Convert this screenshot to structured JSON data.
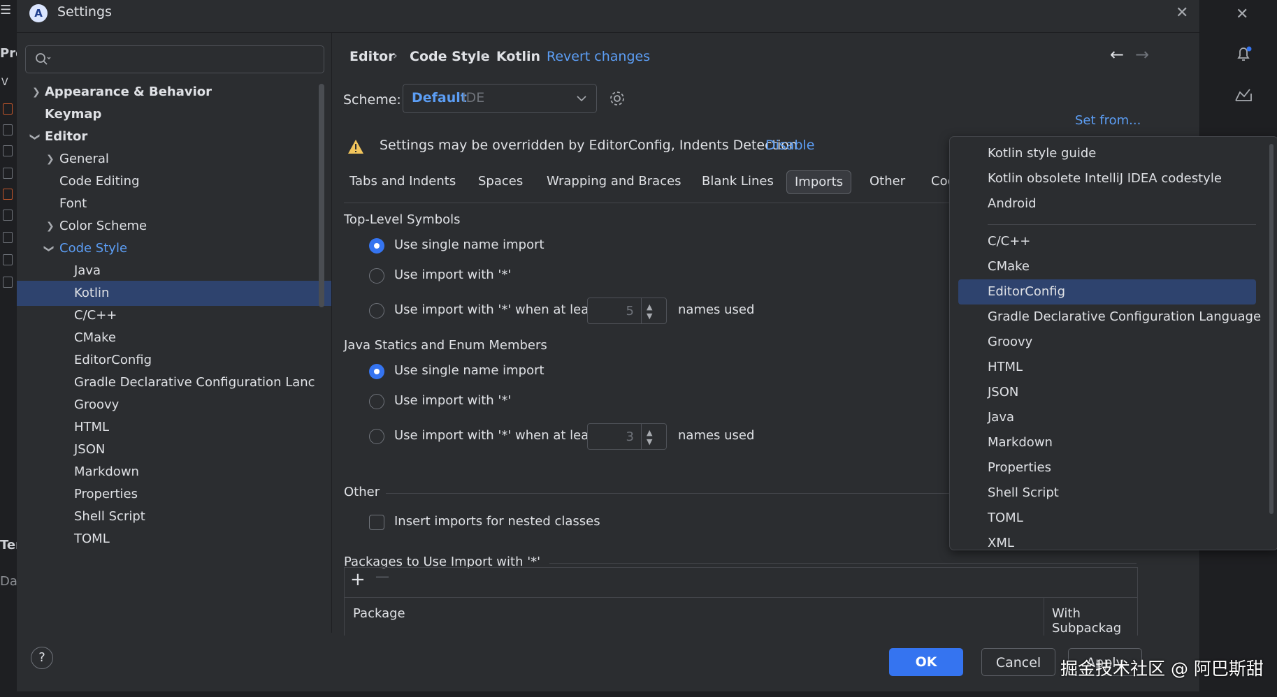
{
  "ide": {
    "left_fragments": [
      "Pro",
      "V",
      "Ter",
      "Da"
    ],
    "bell_icon": "bell-icon",
    "ai_icon": "ai-assistant-icon"
  },
  "window": {
    "title": "Settings",
    "logo_letter": "A"
  },
  "search": {
    "placeholder": ""
  },
  "sidebar": {
    "items": [
      {
        "label": "Appearance & Behavior"
      },
      {
        "label": "Keymap"
      },
      {
        "label": "Editor"
      },
      {
        "label": "General"
      },
      {
        "label": "Code Editing"
      },
      {
        "label": "Font"
      },
      {
        "label": "Color Scheme"
      },
      {
        "label": "Code Style"
      },
      {
        "label": "Java"
      },
      {
        "label": "Kotlin"
      },
      {
        "label": "C/C++"
      },
      {
        "label": "CMake"
      },
      {
        "label": "EditorConfig"
      },
      {
        "label": "Gradle Declarative Configuration Lanc"
      },
      {
        "label": "Groovy"
      },
      {
        "label": "HTML"
      },
      {
        "label": "JSON"
      },
      {
        "label": "Markdown"
      },
      {
        "label": "Properties"
      },
      {
        "label": "Shell Script"
      },
      {
        "label": "TOML"
      }
    ]
  },
  "breadcrumb": {
    "items": [
      "Editor",
      "Code Style",
      "Kotlin"
    ],
    "separator": "›",
    "revert": "Revert changes"
  },
  "nav": {
    "back": "←",
    "forward": "→"
  },
  "scheme": {
    "label": "Scheme:",
    "name": "Default",
    "type": "IDE",
    "set_from": "Set from..."
  },
  "warning": {
    "text": "Settings may be overridden by EditorConfig, Indents Detection",
    "action": "Disable"
  },
  "tabs": [
    "Tabs and Indents",
    "Spaces",
    "Wrapping and Braces",
    "Blank Lines",
    "Imports",
    "Other",
    "Coc"
  ],
  "active_tab": "Imports",
  "top_level": {
    "title": "Top-Level Symbols",
    "opt_single": "Use single name import",
    "opt_star": "Use import with '*'",
    "opt_star_min": "Use import with '*' when at least",
    "count": "5",
    "suffix": "names used",
    "selected": "single"
  },
  "java_statics": {
    "title": "Java Statics and Enum Members",
    "opt_single": "Use single name import",
    "opt_star": "Use import with '*'",
    "opt_star_min": "Use import with '*' when at least",
    "count": "3",
    "suffix": "names used",
    "selected": "single"
  },
  "other": {
    "title": "Other",
    "nested": "Insert imports for nested classes",
    "nested_checked": false
  },
  "packages": {
    "title": "Packages to Use Import with '*'",
    "add": "+",
    "remove": "—",
    "col_package": "Package",
    "col_with_sub": "With Subpackag"
  },
  "footer": {
    "help": "?",
    "ok": "OK",
    "cancel": "Cancel",
    "apply": "Apply"
  },
  "popup": {
    "group1": [
      "Kotlin style guide",
      "Kotlin obsolete IntelliJ IDEA codestyle",
      "Android"
    ],
    "group2": [
      "C/C++",
      "CMake",
      "EditorConfig",
      "Gradle Declarative Configuration Language",
      "Groovy",
      "HTML",
      "JSON",
      "Java",
      "Markdown",
      "Properties",
      "Shell Script",
      "TOML",
      "XML"
    ],
    "selected": "EditorConfig"
  },
  "watermark": "掘金技术社区 @ 阿巴斯甜",
  "colors": {
    "accent": "#3574f0",
    "link": "#5c9ef5",
    "selection": "#2e436e",
    "warning": "#f2c55c",
    "background": "#2b2d30"
  }
}
